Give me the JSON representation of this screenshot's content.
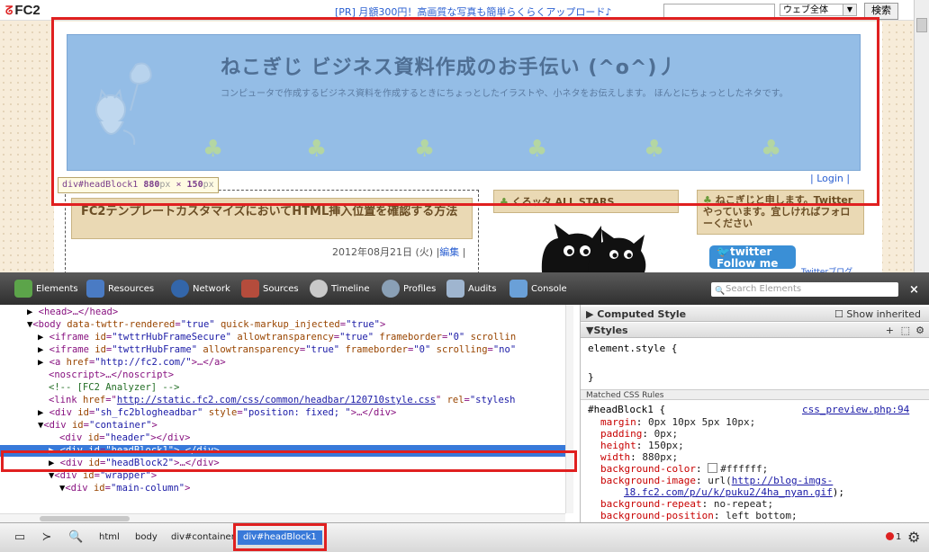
{
  "fc2bar": {
    "logo": "FC2",
    "pr_text": "[PR] 月額300円！高画質な写真も簡単らくらくアップロード♪",
    "search_value": "",
    "scope_select": "ウェブ全体",
    "search_button": "検索"
  },
  "blog": {
    "title": "ねこぎじ ビジネス資料作成のお手伝い (^o^)丿",
    "description": "コンピュータで作成するビジネス資料を作成するときにちょっとしたイラストや、小ネタをお伝えします。 ほんとにちょっとしたネタです。",
    "login": "| Login |",
    "post_title": "FC2テンプレートカスタマイズにおいてHTML挿入位置を確認する方法",
    "post_date": "2012年08月21日 (火) |",
    "post_edit": "編集",
    "side1_title": "くろッタ ALL STARS",
    "side2_title": "ねこぎじと申します。Twitterやっています。宜しければフォローください",
    "twitter_line1": "twitter",
    "twitter_line2": "Follow me",
    "twitter_side": "Twitterブログ"
  },
  "tooltip": {
    "selector": "div#headBlock1",
    "width": "880",
    "height": "150",
    "unit": "px",
    "times": "×"
  },
  "devtools": {
    "tabs": [
      "Elements",
      "Resources",
      "Network",
      "Sources",
      "Timeline",
      "Profiles",
      "Audits",
      "Console"
    ],
    "search_placeholder": "Search Elements",
    "dom": {
      "l1": "<head>…</head>",
      "l2_tag": "<body",
      "l2_a1n": "data-twttr-rendered",
      "l2_a1v": "\"true\"",
      "l2_a2n": "quick-markup_injected",
      "l2_a2v": "\"true\"",
      "l3_tag": "<iframe",
      "l3_a1n": "id",
      "l3_a1v": "\"twttrHubFrameSecure\"",
      "l3_a2n": "allowtransparency",
      "l3_a2v": "\"true\"",
      "l3_a3n": "frameborder",
      "l3_a3v": "\"0\"",
      "l3_a4n": "scrollin",
      "l4_tag": "<iframe",
      "l4_a1n": "id",
      "l4_a1v": "\"twttrHubFrame\"",
      "l4_a2n": "allowtransparency",
      "l4_a2v": "\"true\"",
      "l4_a3n": "frameborder",
      "l4_a3v": "\"0\"",
      "l4_a4n": "scrolling",
      "l4_a4v": "\"no\"",
      "l5_tag": "<a",
      "l5_an": "href",
      "l5_av": "\"http://fc2.com/\"",
      "l5_end": ">…</a>",
      "l6": "<noscript>…</noscript>",
      "l7": "<!-- [FC2 Analyzer]  -->",
      "l8_tag": "<link",
      "l8_an": "href",
      "l8_av": "http://static.fc2.com/css/common/headbar/120710style.css",
      "l8_a2n": "rel",
      "l8_a2v": "\"stylesh",
      "l9_tag": "<div",
      "l9_a1n": "id",
      "l9_a1v": "\"sh_fc2blogheadbar\"",
      "l9_a2n": "style",
      "l9_a2v": "\"position: fixed; \"",
      "l9_end": ">…</div>",
      "l10_tag": "<div",
      "l10_an": "id",
      "l10_av": "\"container\"",
      "l10_end": ">",
      "l11_tag": "<div",
      "l11_an": "id",
      "l11_av": "\"header\"",
      "l11_end": "></div>",
      "l12_tag": "<div",
      "l12_an": "id",
      "l12_av": "\"headBlock1\"",
      "l12_end": ">…</div>",
      "l13_tag": "<div",
      "l13_an": "id",
      "l13_av": "\"headBlock2\"",
      "l13_end": ">…</div>",
      "l14_tag": "<div",
      "l14_an": "id",
      "l14_av": "\"wrapper\"",
      "l14_end": ">",
      "l15_tag": "<div",
      "l15_an": "id",
      "l15_av": "\"main-column\"",
      "l15_end": ">"
    },
    "styles": {
      "computed_header": "Computed Style",
      "show_inherited": "Show inherited",
      "styles_header": "Styles",
      "element_style": "element.style {",
      "element_style_close": "}",
      "matched_header": "Matched CSS Rules",
      "rule_selector": "#headBlock1 {",
      "rule_source": "css_preview.php:94",
      "props": [
        {
          "name": "margin",
          "value": "0px 10px 5px 10px;"
        },
        {
          "name": "padding",
          "value": "0px;"
        },
        {
          "name": "height",
          "value": "150px;"
        },
        {
          "name": "width",
          "value": "880px;"
        },
        {
          "name": "background-color",
          "value": "#ffffff;"
        },
        {
          "name": "background-image",
          "value": "url("
        },
        {
          "name": "background-repeat",
          "value": "no-repeat;"
        },
        {
          "name": "background-position",
          "value": "left bottom;"
        }
      ],
      "bg_url_line1": "http://blog-imgs-",
      "bg_url_line2": "18.fc2.com/p/u/k/puku2/4ha_nyan.gif",
      "bg_url_end": ");"
    },
    "breadcrumbs": [
      "html",
      "body",
      "div#container",
      "div#headBlock1"
    ],
    "error_count": "1",
    "colors": {
      "selection": "#3879d9",
      "highlight": "#e02020"
    }
  }
}
